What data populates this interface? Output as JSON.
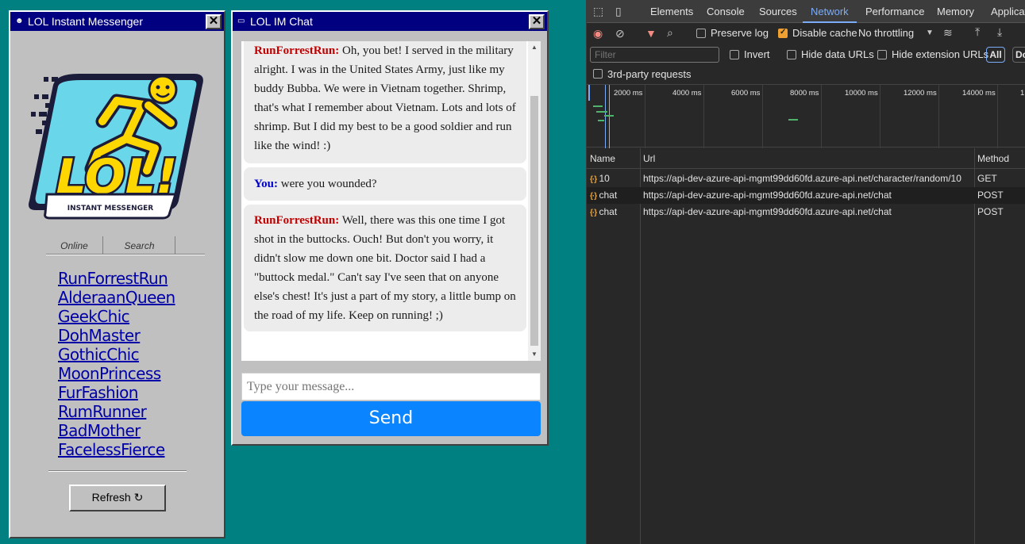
{
  "buddy_window": {
    "title": "LOL Instant Messenger",
    "close": "✕",
    "logo_text": "LOL!",
    "logo_subtitle": "INSTANT MESSENGER",
    "tabs": [
      "Online",
      "Search"
    ],
    "buddies": [
      "RunForrestRun",
      "AlderaanQueen",
      "GeekChic",
      "DohMaster",
      "GothicChic",
      "MoonPrincess",
      "FurFashion",
      "RumRunner",
      "BadMother",
      "FacelessFierce"
    ],
    "refresh_label": "Refresh ↻"
  },
  "chat_window": {
    "title": "LOL IM Chat",
    "close": "✕",
    "messages": [
      {
        "sender": "RunForrestRun:",
        "text": " Oh, you bet! I served in the military alright. I was in the United States Army, just like my buddy Bubba. We were in Vietnam together. Shrimp, that's what I remember about Vietnam. Lots and lots of shrimp. But I did my best to be a good soldier and run like the wind! :)"
      },
      {
        "sender": "You:",
        "text": " were you wounded?"
      },
      {
        "sender": "RunForrestRun:",
        "text": " Well, there was this one time I got shot in the buttocks. Ouch! But don't you worry, it didn't slow me down one bit. Doctor said I had a \"buttock medal.\" Can't say I've seen that on anyone else's chest! It's just a part of my story, a little bump on the road of my life. Keep on running! ;)"
      }
    ],
    "input_placeholder": "Type your message...",
    "send_label": "Send"
  },
  "devtools": {
    "tabs": [
      "Elements",
      "Console",
      "Sources",
      "Network",
      "Performance",
      "Memory",
      "Applicat"
    ],
    "active_tab": "Network",
    "toolbar": {
      "preserve_log": "Preserve log",
      "disable_cache": "Disable cache",
      "throttling": "No throttling"
    },
    "filter": {
      "placeholder": "Filter",
      "invert": "Invert",
      "hide_data_urls": "Hide data URLs",
      "hide_extension_urls": "Hide extension URLs",
      "all": "All",
      "doc": "Do"
    },
    "third_party": "3rd-party requests",
    "timeline_ticks": [
      "2000 ms",
      "4000 ms",
      "6000 ms",
      "8000 ms",
      "10000 ms",
      "12000 ms",
      "14000 ms",
      "1"
    ],
    "columns": [
      "Name",
      "Url",
      "Method"
    ],
    "requests": [
      {
        "name": "10",
        "url": "https://api-dev-azure-api-mgmt99dd60fd.azure-api.net/character/random/10",
        "method": "GET"
      },
      {
        "name": "chat",
        "url": "https://api-dev-azure-api-mgmt99dd60fd.azure-api.net/chat",
        "method": "POST"
      },
      {
        "name": "chat",
        "url": "https://api-dev-azure-api-mgmt99dd60fd.azure-api.net/chat",
        "method": "POST"
      }
    ]
  }
}
